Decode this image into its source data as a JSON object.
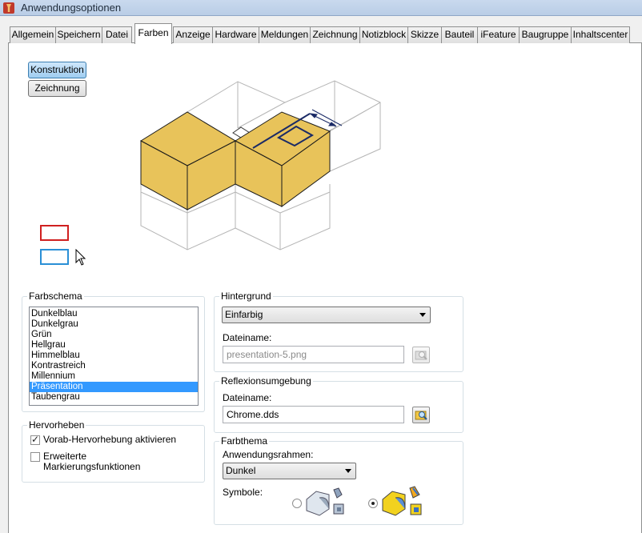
{
  "window": {
    "title": "Anwendungsoptionen"
  },
  "tabs": [
    {
      "label": "Allgemein",
      "active": false
    },
    {
      "label": "Speichern",
      "active": false
    },
    {
      "label": "Datei",
      "active": false
    },
    {
      "label": "Farben",
      "active": true
    },
    {
      "label": "Anzeige",
      "active": false
    },
    {
      "label": "Hardware",
      "active": false
    },
    {
      "label": "Meldungen",
      "active": false
    },
    {
      "label": "Zeichnung",
      "active": false
    },
    {
      "label": "Notizblock",
      "active": false
    },
    {
      "label": "Skizze",
      "active": false
    },
    {
      "label": "Bauteil",
      "active": false
    },
    {
      "label": "iFeature",
      "active": false
    },
    {
      "label": "Baugruppe",
      "active": false
    },
    {
      "label": "Inhaltscenter",
      "active": false
    }
  ],
  "mode_buttons": {
    "konstruktion": "Konstruktion",
    "zeichnung": "Zeichnung",
    "selected": "konstruktion"
  },
  "preview": {
    "highlight_color": "#e8c35a",
    "selection_swatch_color": "#d02020",
    "preselection_swatch_color": "#2a8fd6"
  },
  "farbschema": {
    "label": "Farbschema",
    "items": [
      "Dunkelblau",
      "Dunkelgrau",
      "Grün",
      "Hellgrau",
      "Himmelblau",
      "Kontrastreich",
      "Millennium",
      "Präsentation",
      "Taubengrau"
    ],
    "selected_index": 7
  },
  "hervorheben": {
    "label": "Hervorheben",
    "vorab_label": "Vorab-Hervorhebung aktivieren",
    "vorab_checked": true,
    "erweiterte_line1": "Erweiterte",
    "erweiterte_line2": "Markierungsfunktionen",
    "erweiterte_checked": false
  },
  "hintergrund": {
    "label": "Hintergrund",
    "mode": "Einfarbig",
    "filename_label": "Dateiname:",
    "filename": "presentation-5.png"
  },
  "reflexion": {
    "label": "Reflexionsumgebung",
    "filename_label": "Dateiname:",
    "filename": "Chrome.dds"
  },
  "farbthema": {
    "label": "Farbthema",
    "rahmen_label": "Anwendungsrahmen:",
    "rahmen_value": "Dunkel",
    "symbole_label": "Symbole:",
    "symbol_set_selected": 2
  }
}
